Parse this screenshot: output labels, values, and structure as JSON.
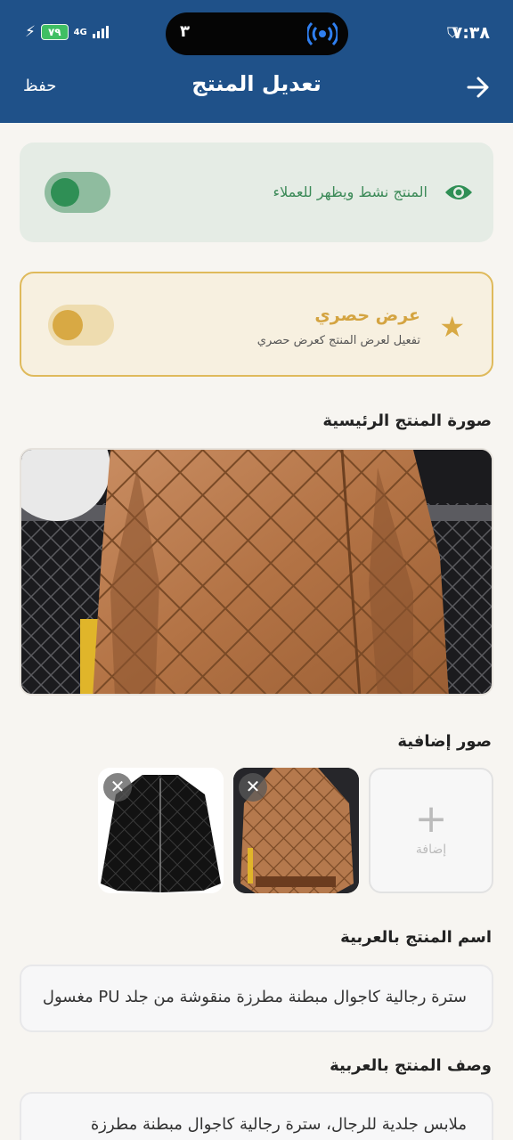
{
  "status": {
    "time": "٧:٣٨",
    "battery": "٧٩",
    "network": "4G",
    "island_count": "٣"
  },
  "nav": {
    "title": "تعديل المنتج",
    "save_label": "حفظ"
  },
  "active_toggle": {
    "label": "المنتج نشط ويظهر للعملاء",
    "on": true
  },
  "exclusive_toggle": {
    "title": "عرض حصري",
    "subtitle": "تفعيل لعرض المنتج كعرض حصري",
    "on": true
  },
  "main_image": {
    "label": "صورة المنتج الرئيسية"
  },
  "extra_images": {
    "label": "صور إضافية",
    "add_label": "إضافة",
    "remove_symbol": "✕"
  },
  "name_field": {
    "label": "اسم المنتج بالعربية",
    "value": "سترة رجالية كاجوال مبطنة مطرزة منقوشة من جلد PU مغسول"
  },
  "desc_field": {
    "label": "وصف المنتج بالعربية",
    "value": "ملابس جلدية للرجال، سترة رجالية كاجوال مبطنة مطرزة"
  },
  "colors": {
    "header": "#1f5189",
    "active_green": "#2f8f55",
    "exclusive_gold": "#d8a944"
  }
}
